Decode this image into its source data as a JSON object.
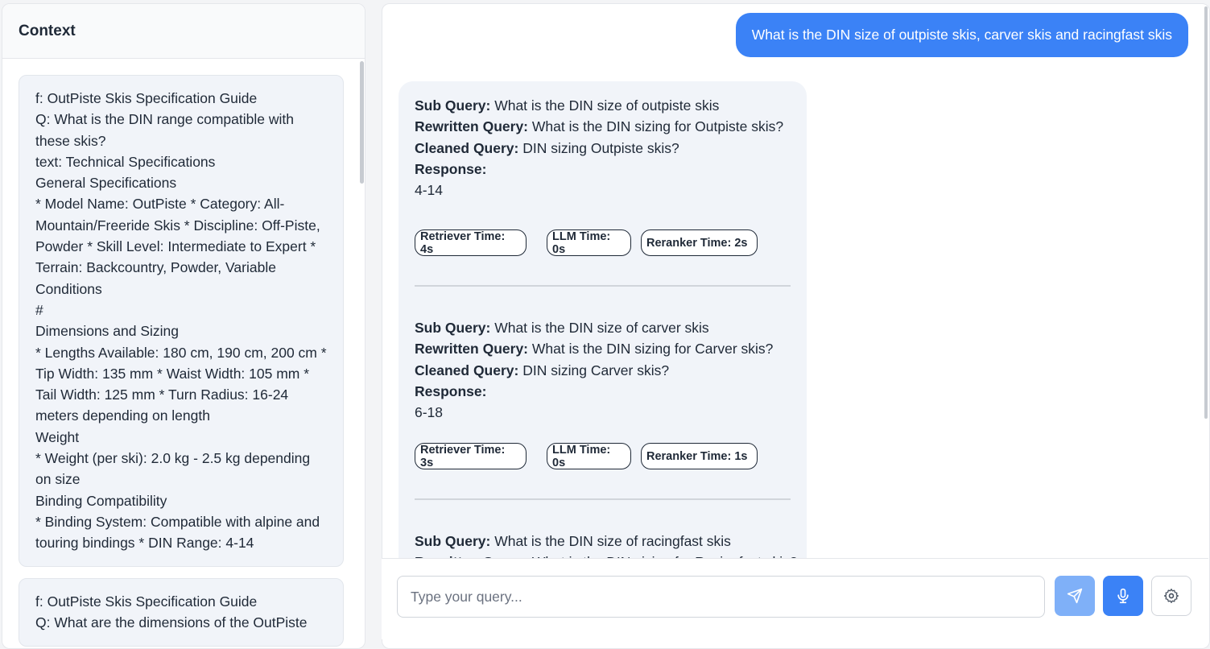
{
  "context_panel": {
    "title": "Context",
    "cards": [
      {
        "lines": [
          "f: OutPiste Skis Specification Guide",
          "Q: What is the DIN range compatible with these skis?",
          "text: Technical Specifications",
          "General Specifications",
          "* Model Name: OutPiste * Category: All-Mountain/Freeride Skis * Discipline: Off-Piste, Powder * Skill Level: Intermediate to Expert * Terrain: Backcountry, Powder, Variable Conditions",
          "#",
          "Dimensions and Sizing",
          "* Lengths Available: 180 cm, 190 cm, 200 cm * Tip Width: 135 mm * Waist Width: 105 mm * Tail Width: 125 mm * Turn Radius: 16-24 meters depending on length",
          "Weight",
          "* Weight (per ski): 2.0 kg - 2.5 kg depending on size",
          "Binding Compatibility",
          "* Binding System: Compatible with alpine and touring bindings * DIN Range: 4-14"
        ]
      },
      {
        "lines": [
          "f: OutPiste Skis Specification Guide",
          "Q: What are the dimensions of the OutPiste"
        ]
      }
    ]
  },
  "chat": {
    "user_message": "What is the DIN size of outpiste skis, carver skis and racingfast skis",
    "labels": {
      "sub_query": "Sub Query:",
      "rewritten_query": "Rewritten Query:",
      "cleaned_query": "Cleaned Query:",
      "response": "Response:"
    },
    "sub_queries": [
      {
        "sub_query": "What is the DIN size of outpiste skis",
        "rewritten_query": "What is the DIN sizing for Outpiste skis?",
        "cleaned_query": "DIN sizing Outpiste skis?",
        "response": "4-14",
        "retriever_time": "Retriever Time: 4s",
        "llm_time": "LLM Time: 0s",
        "reranker_time": "Reranker Time: 2s"
      },
      {
        "sub_query": "What is the DIN size of carver skis",
        "rewritten_query": "What is the DIN sizing for Carver skis?",
        "cleaned_query": "DIN sizing Carver skis?",
        "response": "6-18",
        "retriever_time": "Retriever Time: 3s",
        "llm_time": "LLM Time: 0s",
        "reranker_time": "Reranker Time: 1s"
      },
      {
        "sub_query": "What is the DIN size of racingfast skis",
        "rewritten_query": "What is the DIN sizing for Racingfast skis?"
      }
    ]
  },
  "input_bar": {
    "placeholder": "Type your query...",
    "send_icon": "send-icon",
    "mic_icon": "microphone-icon",
    "settings_icon": "gear-icon"
  },
  "colors": {
    "primary": "#3b82f6",
    "send_disabled": "#7fb0f8",
    "card_bg": "#f1f4f9"
  }
}
